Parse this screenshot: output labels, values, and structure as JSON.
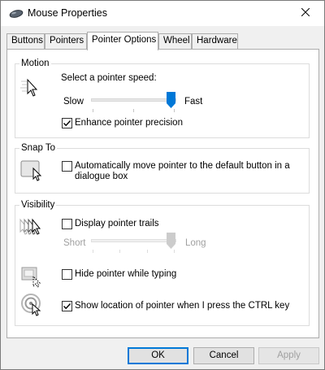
{
  "window": {
    "title": "Mouse Properties",
    "icon": "mouse-icon",
    "close_icon": "close-icon"
  },
  "tabs": [
    {
      "label": "Buttons",
      "active": false
    },
    {
      "label": "Pointers",
      "active": false
    },
    {
      "label": "Pointer Options",
      "active": true
    },
    {
      "label": "Wheel",
      "active": false
    },
    {
      "label": "Hardware",
      "active": false
    }
  ],
  "motion": {
    "title": "Motion",
    "speed_label": "Select a pointer speed:",
    "slow_label": "Slow",
    "fast_label": "Fast",
    "speed_value": 1.0,
    "enhance_label": "Enhance pointer precision",
    "enhance_checked": true
  },
  "snap_to": {
    "title": "Snap To",
    "label_line1": "Automatically move pointer to the default button in a",
    "label_line2": "dialogue box",
    "checked": false
  },
  "visibility": {
    "title": "Visibility",
    "trails_label": "Display pointer trails",
    "trails_checked": false,
    "short_label": "Short",
    "long_label": "Long",
    "trails_value": 1.0,
    "hide_label": "Hide pointer while typing",
    "hide_checked": false,
    "show_location_label": "Show location of pointer when I press the CTRL key",
    "show_location_checked": true
  },
  "buttons": {
    "ok": "OK",
    "cancel": "Cancel",
    "apply": "Apply"
  },
  "colors": {
    "accent": "#0078d7",
    "disabled_text": "#a0a0a0"
  }
}
